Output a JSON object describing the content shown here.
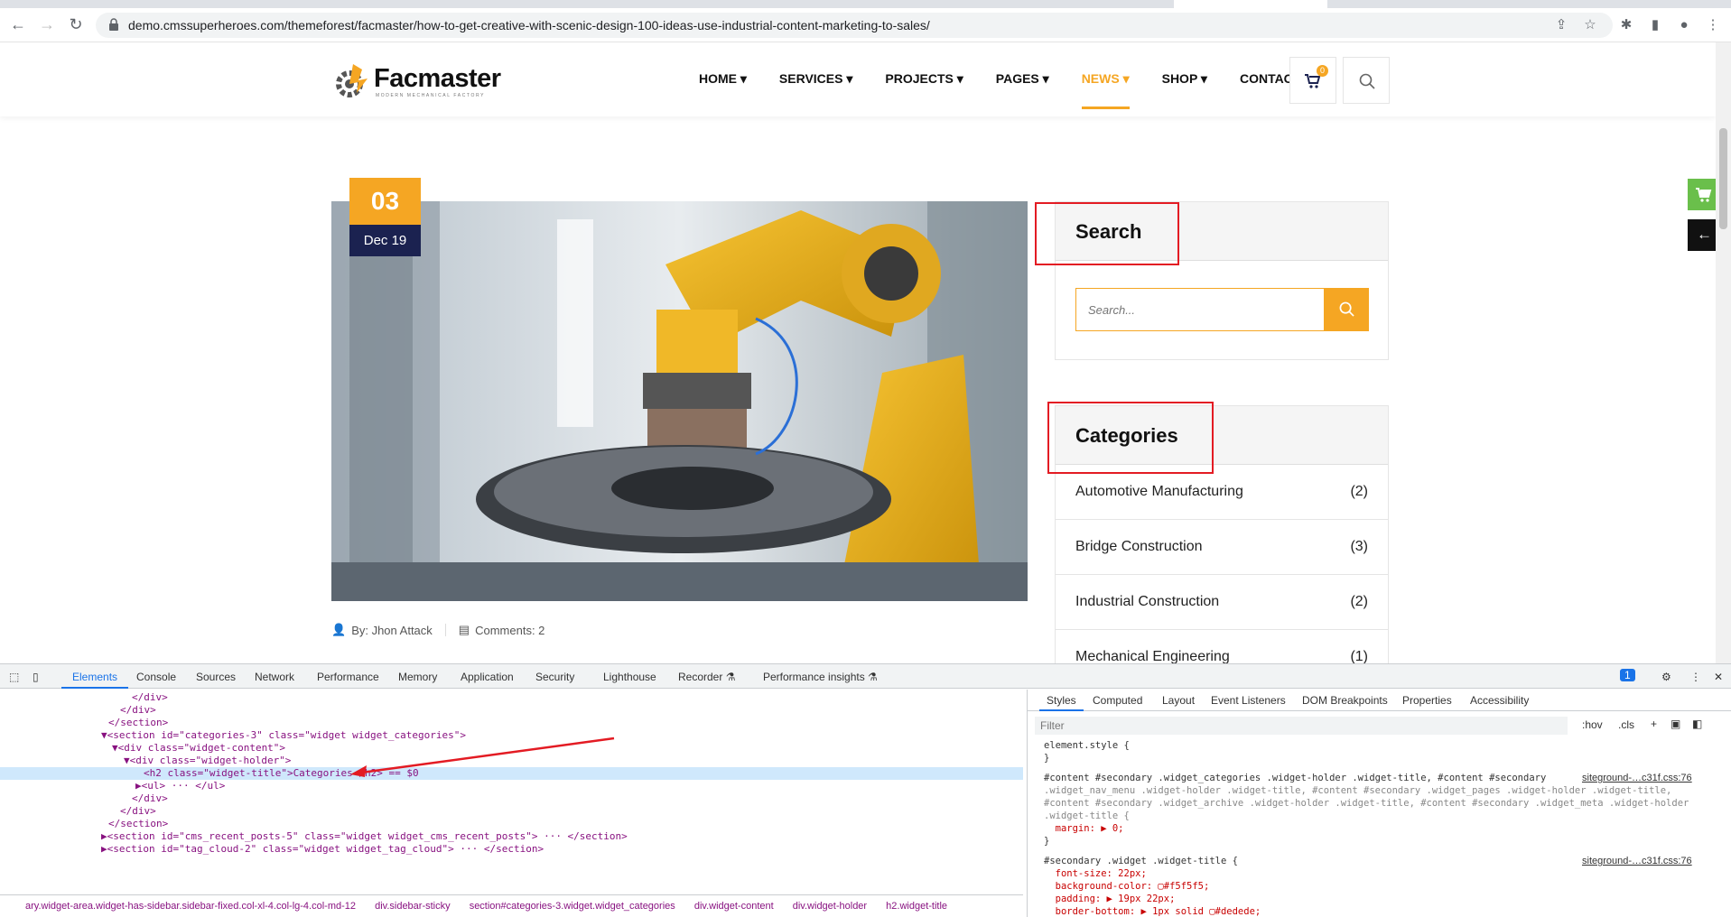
{
  "browser": {
    "url": "demo.cmssuperheroes.com/themeforest/facmaster/how-to-get-creative-with-scenic-design-100-ideas-use-industrial-content-marketing-to-sales/"
  },
  "site": {
    "brand": "Facmaster",
    "tagline": "MODERN MECHANICAL FACTORY",
    "menu": [
      {
        "label": "HOME ▾"
      },
      {
        "label": "SERVICES ▾"
      },
      {
        "label": "PROJECTS ▾"
      },
      {
        "label": "PAGES ▾"
      },
      {
        "label": "NEWS ▾"
      },
      {
        "label": "SHOP ▾"
      },
      {
        "label": "CONTACT"
      }
    ],
    "cart_count": "0",
    "accent": "#f5a623",
    "navy": "#1b2250"
  },
  "post": {
    "day": "03",
    "month": "Dec 19",
    "author": "By: Jhon Attack",
    "comments": "Comments: 2"
  },
  "sidebar": {
    "search_title": "Search",
    "search_placeholder": "Search...",
    "categories_title": "Categories",
    "categories": [
      {
        "name": "Automotive Manufacturing",
        "count": "(2)"
      },
      {
        "name": "Bridge Construction",
        "count": "(3)"
      },
      {
        "name": "Industrial Construction",
        "count": "(2)"
      },
      {
        "name": "Mechanical Engineering",
        "count": "(1)"
      }
    ]
  },
  "devtools": {
    "tabs": [
      "Elements",
      "Console",
      "Sources",
      "Network",
      "Performance",
      "Memory",
      "Application",
      "Security",
      "Lighthouse",
      "Recorder ⚗",
      "Performance insights ⚗"
    ],
    "issues_count": "1",
    "dom": [
      {
        "t": "</div>"
      },
      {
        "t": "</div>"
      },
      {
        "t": "</section>"
      },
      {
        "t": "▼<section id=\"categories-3\" class=\"widget widget_categories\">"
      },
      {
        "t": "▼<div class=\"widget-content\">"
      },
      {
        "t": "▼<div class=\"widget-holder\">"
      },
      {
        "t": "<h2 class=\"widget-title\">Categories</h2> == $0"
      },
      {
        "t": "▶<ul> ··· </ul>"
      },
      {
        "t": "</div>"
      },
      {
        "t": "</div>"
      },
      {
        "t": "</section>"
      },
      {
        "t": "▶<section id=\"cms_recent_posts-5\" class=\"widget widget_cms_recent_posts\"> ··· </section>"
      },
      {
        "t": "▶<section id=\"tag_cloud-2\" class=\"widget widget_tag_cloud\"> ··· </section>"
      }
    ],
    "breadcrumbs": [
      "ary.widget-area.widget-has-sidebar.sidebar-fixed.col-xl-4.col-lg-4.col-md-12",
      "div.sidebar-sticky",
      "section#categories-3.widget.widget_categories",
      "div.widget-content",
      "div.widget-holder",
      "h2.widget-title"
    ],
    "style_tabs": [
      "Styles",
      "Computed",
      "Layout",
      "Event Listeners",
      "DOM Breakpoints",
      "Properties",
      "Accessibility"
    ],
    "filter_placeholder": "Filter",
    "hov": ":hov",
    "cls": ".cls",
    "css": [
      {
        "t": "element.style {"
      },
      {
        "t": "}"
      },
      {
        "t": "#content #secondary .widget_categories .widget-holder .widget-title, #content #secondary"
      },
      {
        "t": ".widget_nav_menu .widget-holder .widget-title, #content #secondary .widget_pages .widget-holder .widget-title,"
      },
      {
        "t": "#content #secondary .widget_archive .widget-holder .widget-title, #content #secondary .widget_meta .widget-holder"
      },
      {
        "t": ".widget-title {"
      },
      {
        "t": "  margin: ▶ 0;"
      },
      {
        "t": "}"
      },
      {
        "t": "#secondary .widget .widget-title {"
      },
      {
        "t": "  font-size: 22px;"
      },
      {
        "t": "  background-color: ▢#f5f5f5;"
      },
      {
        "t": "  padding: ▶ 19px 22px;"
      },
      {
        "t": "  border-bottom: ▶ 1px solid ▢#dedede;"
      }
    ],
    "css_source": "siteground-…c31f.css:76"
  }
}
